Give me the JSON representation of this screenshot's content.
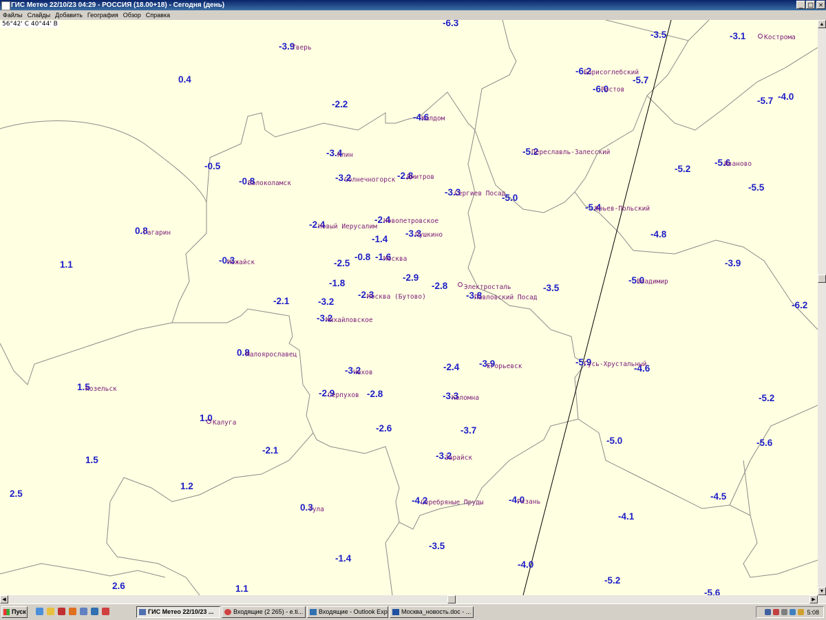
{
  "window": {
    "title": "ГИС Метео 22/10/23 04:29 - РОССИЯ (18.00+18) - Сегодня (день)",
    "minimize": "_",
    "restore": "□",
    "close": "×"
  },
  "menu": [
    "Файлы",
    "Слайды",
    "Добавить",
    "География",
    "Обзор",
    "Справка"
  ],
  "map": {
    "coordinates": "56°42' С 40°44' В",
    "values": [
      "-6.3",
      "-3.5",
      "-3.1",
      "-3.9",
      "0.4",
      "-2.2",
      "-6.2",
      "-5.7",
      "-6.0",
      "-5.7",
      "-4.0",
      "-4.6",
      "-5.2",
      "-3.4",
      "-0.5",
      "-0.8",
      "-3.2",
      "-2.8",
      "-5.2",
      "-5.6",
      "-5.5",
      "-3.3",
      "-5.0",
      "-5.4",
      "-2.4",
      "-2.4",
      "0.8",
      "-1.4",
      "-3.3",
      "-4.8",
      "1.1",
      "-0.3",
      "-2.5",
      "-0.8",
      "-1.6",
      "-3.9",
      "-1.8",
      "-2.9",
      "-2.8",
      "-3.5",
      "-5.0",
      "-2.1",
      "-3.2",
      "-2.3",
      "-3.8",
      "-6.2",
      "-3.2",
      "0.8",
      "-3.2",
      "-2.4",
      "-3.9",
      "-5.9",
      "-4.6",
      "1.5",
      "-2.9",
      "-2.8",
      "-3.3",
      "-5.2",
      "1.0",
      "-2.6",
      "-3.7",
      "-5.0",
      "-5.6",
      "1.5",
      "-2.1",
      "-3.2",
      "1.2",
      "-4.5",
      "2.5",
      "-4.2",
      "-4.0",
      "0.3",
      "-4.1",
      "-3.5",
      "-1.4",
      "-4.0",
      "2.6",
      "1.1",
      "-5.2",
      "-5.6"
    ],
    "cities": [
      "Тверь",
      "Кострома",
      "Борисоглебский",
      "Ростов",
      "Калдом",
      "Переславль-Залесский",
      "Клин",
      "Иваново",
      "Волоколамск",
      "Солнечногорск",
      "Дмитров",
      "Сергиев Посад",
      "Юрьев-Польский",
      "Новопетровское",
      "Бутово",
      "Новый Иерусалим",
      "Пушкино",
      "Гагарин",
      "Можайск",
      "Москва",
      "Электросталь",
      "Владимир",
      "Москва (Бутово)",
      "Павловский Посад",
      "Михайловское",
      "Малоярославец",
      "Чехов",
      "Егорьевск",
      "Курлово",
      "Гусь-Хрустальный",
      "Козельск",
      "Серпухов",
      "Коломна",
      "Калуга",
      "Зарайск",
      "Серебряные Пруды",
      "Рязань",
      "Тула",
      "Кашира"
    ]
  },
  "taskbar": {
    "start": "Пуск",
    "tasks": [
      "ГИС Метео 22/10/23 ...",
      "Входящие (2 265) - e.ti...",
      "Входящие - Outlook Exp...",
      "Москва_новость.doc - ..."
    ],
    "clock": "5:08"
  }
}
